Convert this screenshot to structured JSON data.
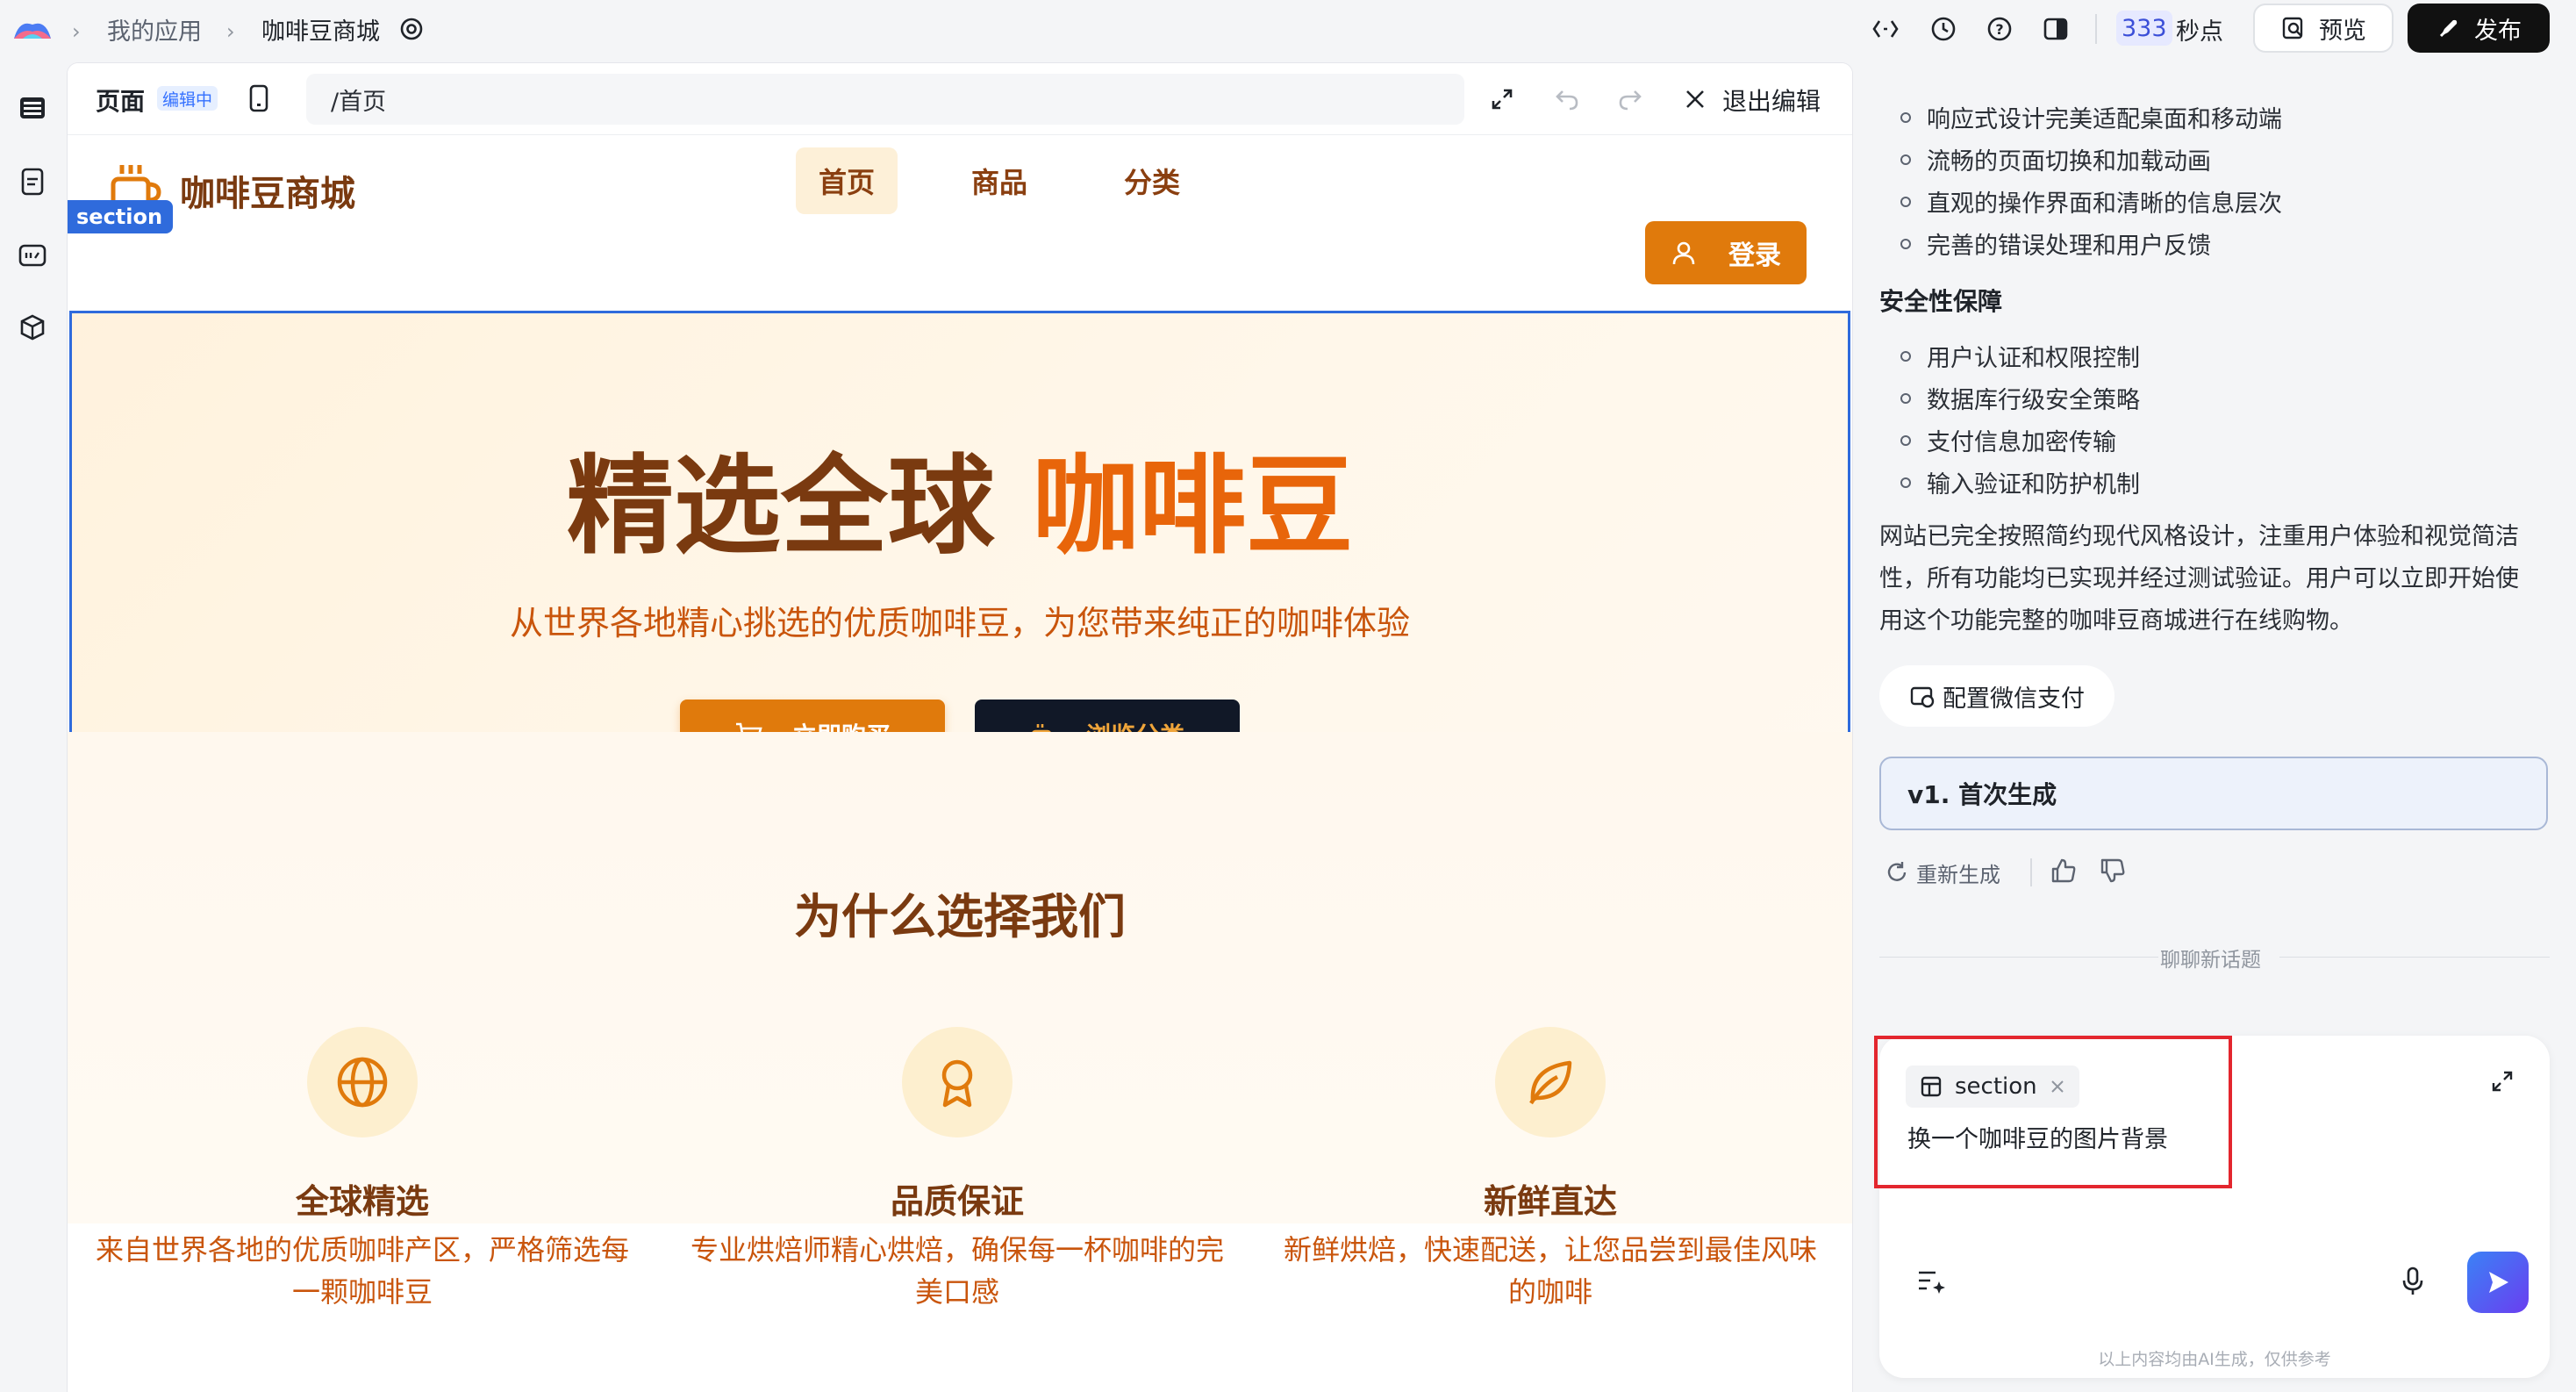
{
  "topbar": {
    "breadcrumb_app_list": "我的应用",
    "breadcrumb_current": "咖啡豆商城",
    "points_value": "333",
    "points_unit": "秒点",
    "preview_label": "预览",
    "publish_label": "发布"
  },
  "editor": {
    "page_label": "页面",
    "editing_badge": "编辑中",
    "path": "/首页",
    "exit_label": "退出编辑",
    "selection_tag": "section"
  },
  "site": {
    "brand": "咖啡豆商城",
    "nav": [
      "首页",
      "商品",
      "分类"
    ],
    "login_label": "登录",
    "hero_title_main": "精选全球",
    "hero_title_accent": "咖啡豆",
    "hero_subtitle": "从世界各地精心挑选的优质咖啡豆，为您带来纯正的咖啡体验",
    "buy_label": "立即购买",
    "browse_label": "浏览分类",
    "features_heading": "为什么选择我们",
    "features": [
      {
        "icon": "globe-icon",
        "title": "全球精选",
        "desc_line1": "来自世界各地的优质咖啡产区，严格筛选每",
        "desc_line2": "一颗咖啡豆"
      },
      {
        "icon": "award-icon",
        "title": "品质保证",
        "desc_line1": "专业烘焙师精心烘焙，确保每一杯咖啡的完",
        "desc_line2": "美口感"
      },
      {
        "icon": "leaf-icon",
        "title": "新鲜直达",
        "desc_line1": "新鲜烘焙，快速配送，让您品尝到最佳风味",
        "desc_line2": "的咖啡"
      }
    ],
    "colors": {
      "brand_orange": "#e07a0c",
      "brand_brown": "#7a3a10",
      "accent_orange": "#e8650a",
      "dark_button": "#111827"
    }
  },
  "panel": {
    "bullets_a": [
      "响应式设计完美适配桌面和移动端",
      "流畅的页面切换和加载动画",
      "直观的操作界面和清晰的信息层次",
      "完善的错误处理和用户反馈"
    ],
    "security_title": "安全性保障",
    "bullets_b": [
      "用户认证和权限控制",
      "数据库行级安全策略",
      "支付信息加密传输",
      "输入验证和防护机制"
    ],
    "summary_line1": "网站已完全按照简约现代风格设计，注重用户体验和视觉简洁",
    "summary_line2": "性，所有功能均已实现并经过测试验证。用户可以立即开始使",
    "summary_line3": "用这个功能完整的咖啡豆商城进行在线购物。",
    "wechat_pay_label": "配置微信支付",
    "version_label": "v1. 首次生成",
    "regenerate_label": "重新生成",
    "new_topic_label": "聊聊新话题",
    "chat_tag": "section",
    "chat_input": "换一个咖啡豆的图片背景",
    "disclaimer": "以上内容均由AI生成，仅供参考"
  }
}
